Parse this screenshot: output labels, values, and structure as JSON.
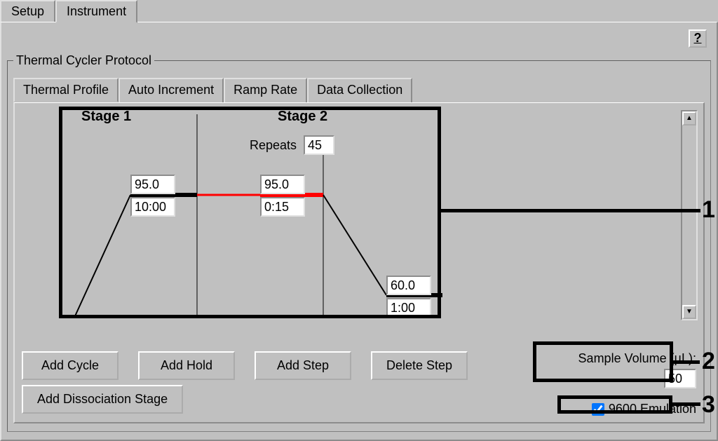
{
  "mainTabs": {
    "setup": "Setup",
    "instrument": "Instrument"
  },
  "protocolTitle": "Thermal Cycler Protocol",
  "subTabs": {
    "thermal": "Thermal Profile",
    "autoInc": "Auto Increment",
    "ramp": "Ramp Rate",
    "dataColl": "Data Collection"
  },
  "stages": {
    "s1": "Stage 1",
    "s2": "Stage 2",
    "repeatsLabel": "Repeats",
    "repeatsValue": "45"
  },
  "steps": {
    "s1_temp": "95.0",
    "s1_time": "10:00",
    "s2a_temp": "95.0",
    "s2a_time": "0:15",
    "s2b_temp": "60.0",
    "s2b_time": "1:00"
  },
  "buttons": {
    "addCycle": "Add Cycle",
    "addHold": "Add Hold",
    "addStep": "Add Step",
    "deleteStep": "Delete Step",
    "addDissoc": "Add Dissociation Stage"
  },
  "sampleVolume": {
    "label": "Sample Volume (µL):",
    "value": "50"
  },
  "emulation": {
    "label": "9600 Emulation",
    "checked": true
  },
  "help": "?",
  "annotations": {
    "n1": "1",
    "n2": "2",
    "n3": "3"
  }
}
